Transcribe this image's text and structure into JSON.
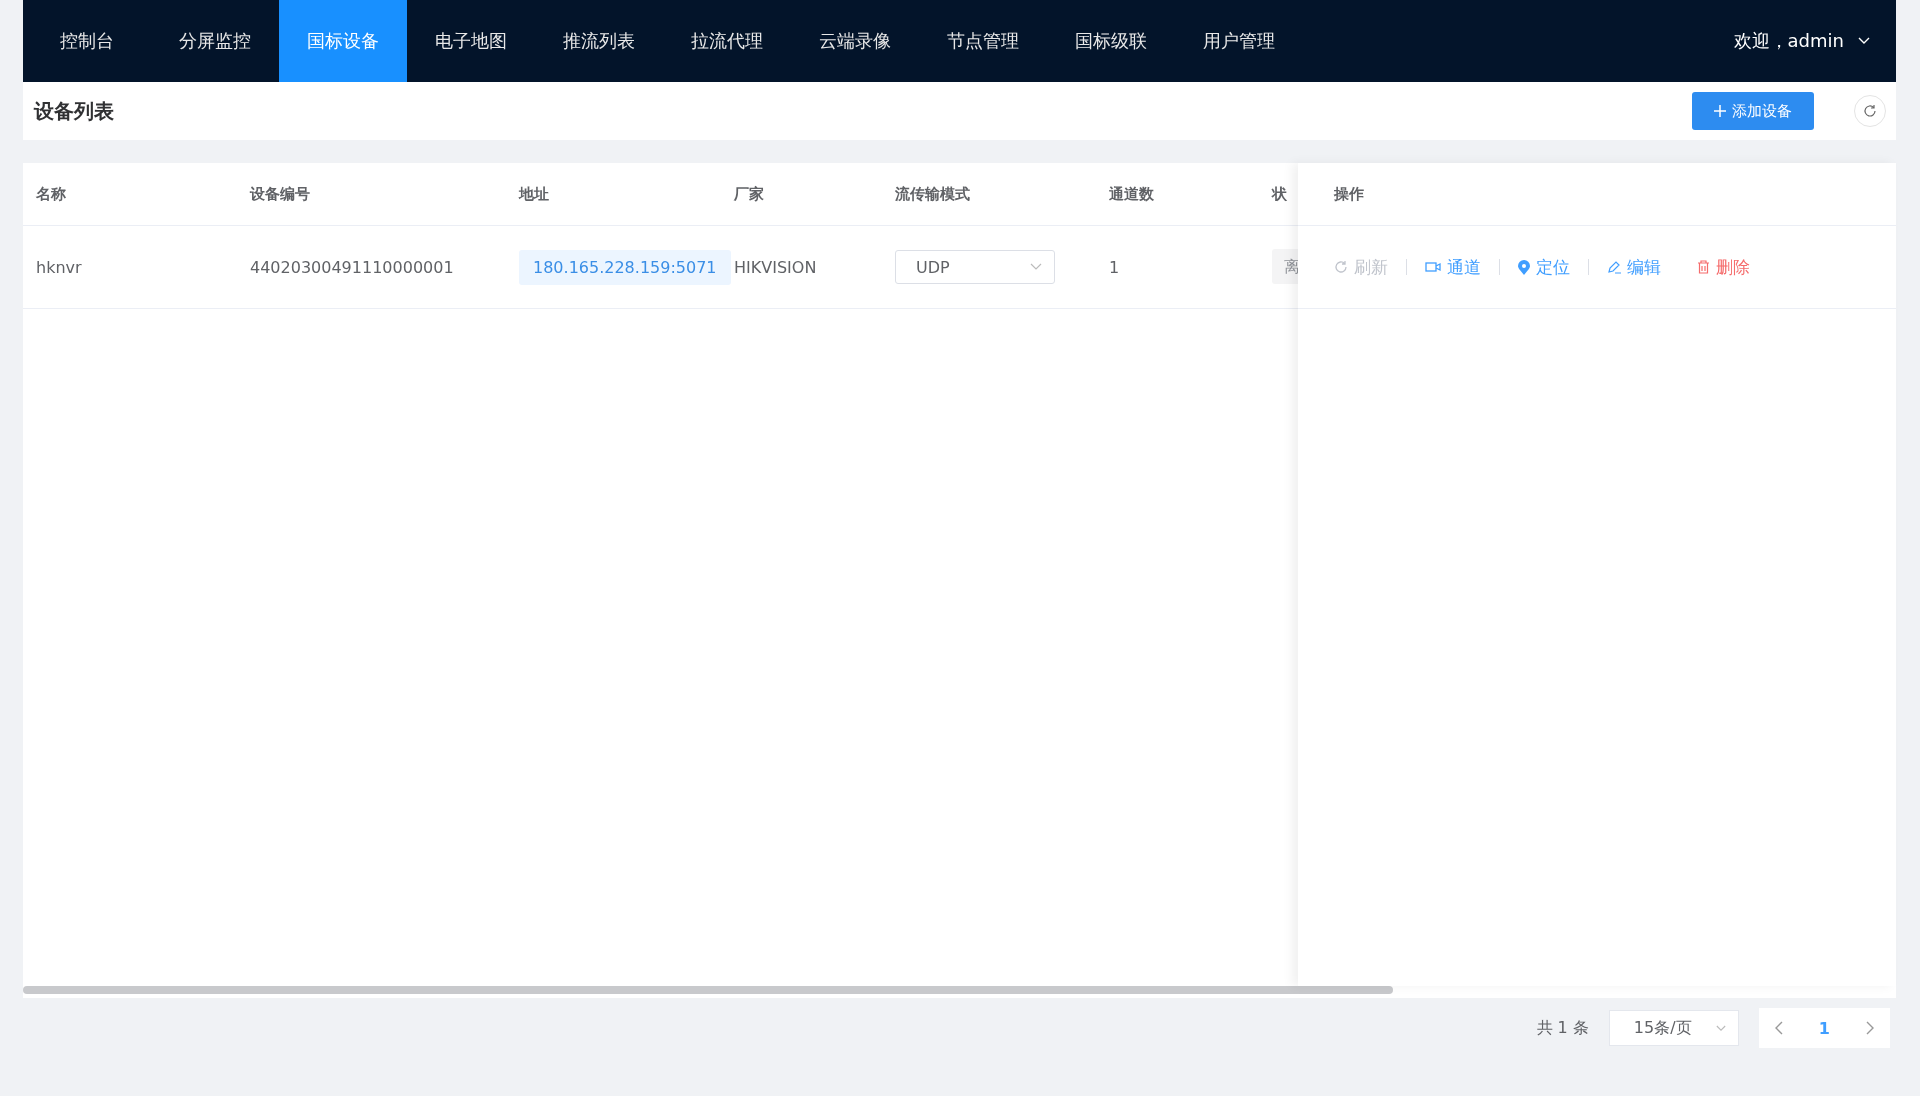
{
  "nav": {
    "items": [
      {
        "label": "控制台",
        "selected": false
      },
      {
        "label": "分屏监控",
        "selected": false
      },
      {
        "label": "国标设备",
        "selected": true
      },
      {
        "label": "电子地图",
        "selected": false
      },
      {
        "label": "推流列表",
        "selected": false
      },
      {
        "label": "拉流代理",
        "selected": false
      },
      {
        "label": "云端录像",
        "selected": false
      },
      {
        "label": "节点管理",
        "selected": false
      },
      {
        "label": "国标级联",
        "selected": false
      },
      {
        "label": "用户管理",
        "selected": false
      }
    ],
    "user": "欢迎，admin"
  },
  "header": {
    "title": "设备列表",
    "add_button": "添加设备"
  },
  "table": {
    "columns": [
      "名称",
      "设备编号",
      "地址",
      "厂家",
      "流传输模式",
      "通道数",
      "状"
    ],
    "actions_column": "操作",
    "rows": [
      {
        "name": "hknvr",
        "device_id": "44020300491110000001",
        "address": "180.165.228.159:5071",
        "vendor": "HIKVISION",
        "transport": "UDP",
        "channels": "1",
        "status": "离",
        "actions": [
          {
            "kind": "refresh",
            "label": "刷新",
            "disabled": true
          },
          {
            "kind": "channel",
            "label": "通道",
            "disabled": false
          },
          {
            "kind": "locate",
            "label": "定位",
            "disabled": false
          },
          {
            "kind": "edit",
            "label": "编辑",
            "disabled": false
          },
          {
            "kind": "delete",
            "label": "删除",
            "disabled": false
          }
        ]
      }
    ]
  },
  "pagination": {
    "total": "共 1 条",
    "page_size": "15条/页",
    "pages": [
      {
        "label": "1",
        "selected": true
      }
    ]
  }
}
